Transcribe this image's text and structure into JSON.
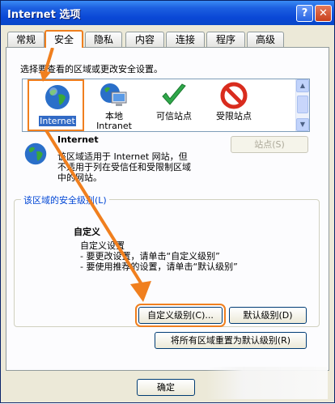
{
  "window": {
    "title": "Internet 选项",
    "help_glyph": "?",
    "close_glyph": "✕"
  },
  "tabs": [
    {
      "label": "常规",
      "active": false
    },
    {
      "label": "安全",
      "active": true
    },
    {
      "label": "隐私",
      "active": false
    },
    {
      "label": "内容",
      "active": false
    },
    {
      "label": "连接",
      "active": false
    },
    {
      "label": "程序",
      "active": false
    },
    {
      "label": "高级",
      "active": false
    }
  ],
  "security": {
    "prompt": "选择要查看的区域或更改安全设置。",
    "zones": [
      {
        "label": "Internet",
        "label2": "",
        "icon": "globe-icon",
        "selected": true
      },
      {
        "label": "本地",
        "label2": "Intranet",
        "icon": "local-intranet-icon",
        "selected": false
      },
      {
        "label": "可信站点",
        "label2": "",
        "icon": "checkmark-icon",
        "selected": false
      },
      {
        "label": "受限站点",
        "label2": "",
        "icon": "no-entry-icon",
        "selected": false
      }
    ],
    "sites_button": "站点(S)",
    "zone_title": "Internet",
    "zone_desc": [
      "该区域适用于 Internet 网站，但",
      "不适用于列在受信任和受限制区域",
      "中的网站。"
    ],
    "level_group_label": "该区域的安全级别(L)",
    "level_name": "自定义",
    "level_lines": [
      "自定义设置",
      "- 要更改设置，请单击“自定义级别”",
      "- 要使用推荐的设置，请单击“默认级别”"
    ],
    "custom_level_button": "自定义级别(C)...",
    "default_level_button": "默认级别(D)",
    "reset_all_button": "将所有区域重置为默认级别(R)"
  },
  "footer": {
    "ok_button": "确定"
  },
  "colors": {
    "highlight": "#f07f1e",
    "title_bar": "#0a47d6",
    "selection": "#316ac5"
  }
}
